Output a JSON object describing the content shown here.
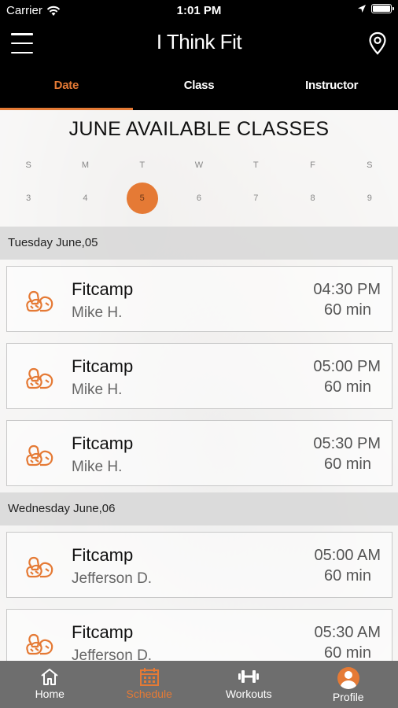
{
  "status_bar": {
    "carrier": "Carrier",
    "time": "1:01 PM"
  },
  "nav": {
    "title": "I Think Fit"
  },
  "tabs": [
    {
      "label": "Date",
      "active": true
    },
    {
      "label": "Class",
      "active": false
    },
    {
      "label": "Instructor",
      "active": false
    }
  ],
  "calendar": {
    "title": "JUNE AVAILABLE CLASSES",
    "day_labels": [
      "S",
      "M",
      "T",
      "W",
      "T",
      "F",
      "S"
    ],
    "dates": [
      "3",
      "4",
      "5",
      "6",
      "7",
      "8",
      "9"
    ],
    "selected_date": "5"
  },
  "sections": [
    {
      "header": "Tuesday June,05",
      "classes": [
        {
          "name": "Fitcamp",
          "instructor": "Mike H.",
          "time": "04:30 PM",
          "duration": "60 min"
        },
        {
          "name": "Fitcamp",
          "instructor": "Mike H.",
          "time": "05:00 PM",
          "duration": "60 min"
        },
        {
          "name": "Fitcamp",
          "instructor": "Mike H.",
          "time": "05:30 PM",
          "duration": "60 min"
        }
      ]
    },
    {
      "header": "Wednesday June,06",
      "classes": [
        {
          "name": "Fitcamp",
          "instructor": "Jefferson D.",
          "time": "05:00 AM",
          "duration": "60 min"
        },
        {
          "name": "Fitcamp",
          "instructor": "Jefferson D.",
          "time": "05:30 AM",
          "duration": "60 min"
        }
      ]
    }
  ],
  "bottom_nav": [
    {
      "label": "Home",
      "icon": "home-icon",
      "active": false
    },
    {
      "label": "Schedule",
      "icon": "calendar-icon",
      "active": true
    },
    {
      "label": "Workouts",
      "icon": "dumbbell-icon",
      "active": false
    },
    {
      "label": "Profile",
      "icon": "avatar",
      "active": false
    }
  ],
  "colors": {
    "accent": "#e57a35",
    "bar": "#000000",
    "bottom_bar": "#6e6e6e"
  }
}
